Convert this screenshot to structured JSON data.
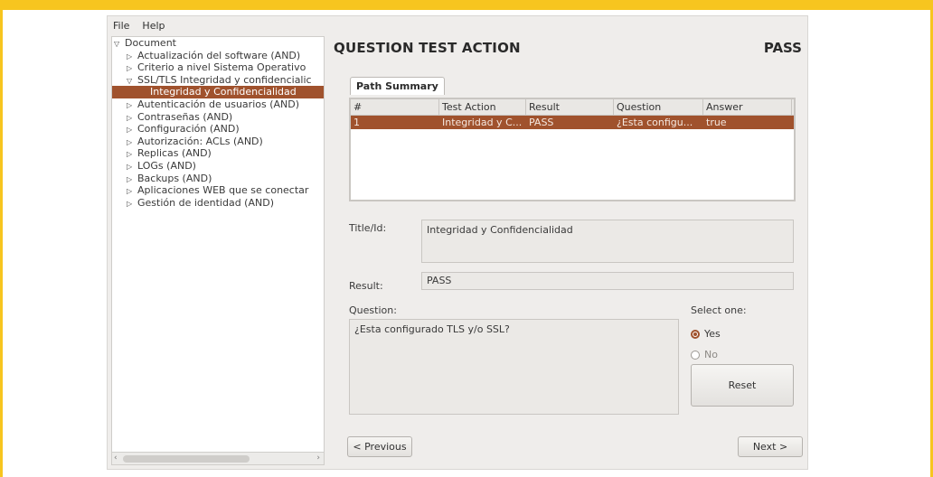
{
  "menu": [
    "File",
    "Help"
  ],
  "tree": {
    "root": "Document",
    "items": [
      {
        "label": "Actualización del software (AND)",
        "level": 1,
        "arrow": "right"
      },
      {
        "label": "Criterio a nivel Sistema Operativo",
        "level": 1,
        "arrow": "right"
      },
      {
        "label": "SSL/TLS Integridad y confidencialic",
        "level": 1,
        "arrow": "down"
      },
      {
        "label": "Integridad y Confidencialidad",
        "level": 2,
        "arrow": "none",
        "selected": true
      },
      {
        "label": "Autenticación de usuarios (AND)",
        "level": 1,
        "arrow": "right"
      },
      {
        "label": "Contraseñas (AND)",
        "level": 1,
        "arrow": "right"
      },
      {
        "label": "Configuración (AND)",
        "level": 1,
        "arrow": "right"
      },
      {
        "label": "Autorización: ACLs (AND)",
        "level": 1,
        "arrow": "right"
      },
      {
        "label": "Replicas (AND)",
        "level": 1,
        "arrow": "right"
      },
      {
        "label": "LOGs (AND)",
        "level": 1,
        "arrow": "right"
      },
      {
        "label": "Backups (AND)",
        "level": 1,
        "arrow": "right"
      },
      {
        "label": "Aplicaciones WEB que se conectar",
        "level": 1,
        "arrow": "right"
      },
      {
        "label": "Gestión de identidad (AND)",
        "level": 1,
        "arrow": "right"
      }
    ]
  },
  "header": {
    "title": "QUESTION TEST ACTION",
    "status": "PASS"
  },
  "tab": {
    "label": "Path Summary"
  },
  "table": {
    "columns": [
      "#",
      "Test Action",
      "Result",
      "Question",
      "Answer"
    ],
    "rows": [
      [
        "1",
        "Integridad y C...",
        "PASS",
        "¿Esta configu...",
        "true"
      ]
    ]
  },
  "form": {
    "title_label": "Title/Id:",
    "title_value": "Integridad y Confidencialidad",
    "result_label": "Result:",
    "result_value": "PASS",
    "question_label": "Question:",
    "question_value": "¿Esta configurado TLS y/o SSL?",
    "select_label": "Select one:",
    "options": [
      {
        "label": "Yes",
        "selected": true
      },
      {
        "label": "No",
        "selected": false
      }
    ],
    "reset_label": "Reset"
  },
  "nav": {
    "previous_label": "< Previous",
    "next_label": "Next >"
  },
  "colors": {
    "frame": "#f7c51f",
    "selection": "#a0522d"
  }
}
